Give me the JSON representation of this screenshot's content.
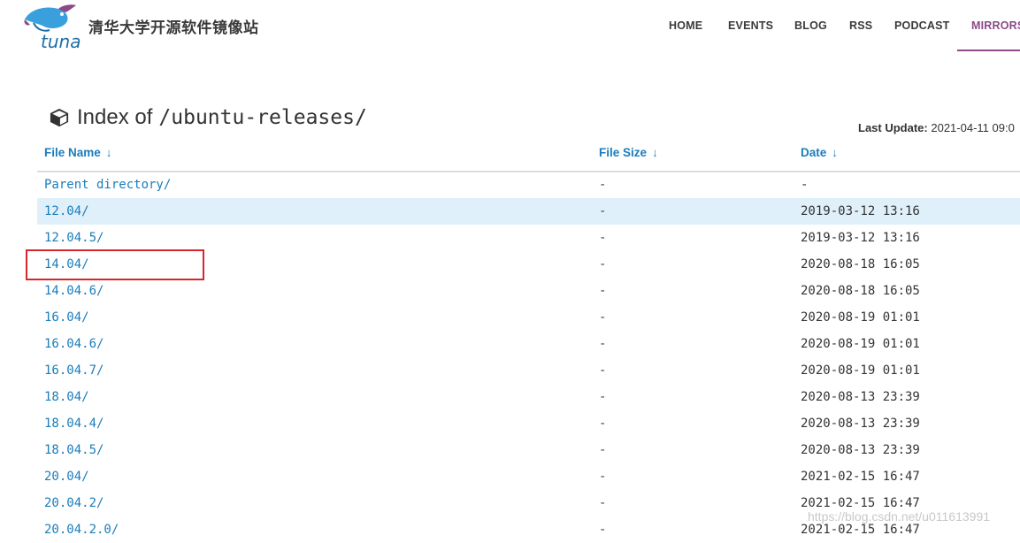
{
  "header": {
    "logo_text": "tuna",
    "site_title": "清华大学开源软件镜像站",
    "nav": [
      {
        "label": "HOME",
        "active": false
      },
      {
        "label": "EVENTS",
        "active": false
      },
      {
        "label": "BLOG",
        "active": false
      },
      {
        "label": "RSS",
        "active": false
      },
      {
        "label": "PODCAST",
        "active": false
      },
      {
        "label": "MIRRORS",
        "active": true
      }
    ],
    "accent_color": "#8a4b86"
  },
  "page": {
    "heading_prefix": "Index of",
    "heading_path": "/ubuntu-releases/",
    "heading_icon": "cube-icon",
    "last_update_label": "Last Update:",
    "last_update_value": "2021-04-11 09:0"
  },
  "table": {
    "columns": [
      {
        "label": "File Name",
        "sort_arrow": "↓"
      },
      {
        "label": "File Size",
        "sort_arrow": "↓"
      },
      {
        "label": "Date",
        "sort_arrow": "↓"
      }
    ],
    "rows": [
      {
        "name": "Parent directory/",
        "size": "-",
        "date": "-"
      },
      {
        "name": "12.04/",
        "size": "-",
        "date": "2019-03-12 13:16"
      },
      {
        "name": "12.04.5/",
        "size": "-",
        "date": "2019-03-12 13:16"
      },
      {
        "name": "14.04/",
        "size": "-",
        "date": "2020-08-18 16:05"
      },
      {
        "name": "14.04.6/",
        "size": "-",
        "date": "2020-08-18 16:05"
      },
      {
        "name": "16.04/",
        "size": "-",
        "date": "2020-08-19 01:01"
      },
      {
        "name": "16.04.6/",
        "size": "-",
        "date": "2020-08-19 01:01"
      },
      {
        "name": "16.04.7/",
        "size": "-",
        "date": "2020-08-19 01:01"
      },
      {
        "name": "18.04/",
        "size": "-",
        "date": "2020-08-13 23:39"
      },
      {
        "name": "18.04.4/",
        "size": "-",
        "date": "2020-08-13 23:39"
      },
      {
        "name": "18.04.5/",
        "size": "-",
        "date": "2020-08-13 23:39"
      },
      {
        "name": "20.04/",
        "size": "-",
        "date": "2021-02-15 16:47"
      },
      {
        "name": "20.04.2/",
        "size": "-",
        "date": "2021-02-15 16:47"
      },
      {
        "name": "20.04.2.0/",
        "size": "-",
        "date": "2021-02-15 16:47"
      }
    ],
    "highlighted_row": 1,
    "annotated_row": 3,
    "link_color": "#1a7dbb",
    "highlight_color": "#dff0fa"
  },
  "watermark": "https://blog.csdn.net/u011613991"
}
